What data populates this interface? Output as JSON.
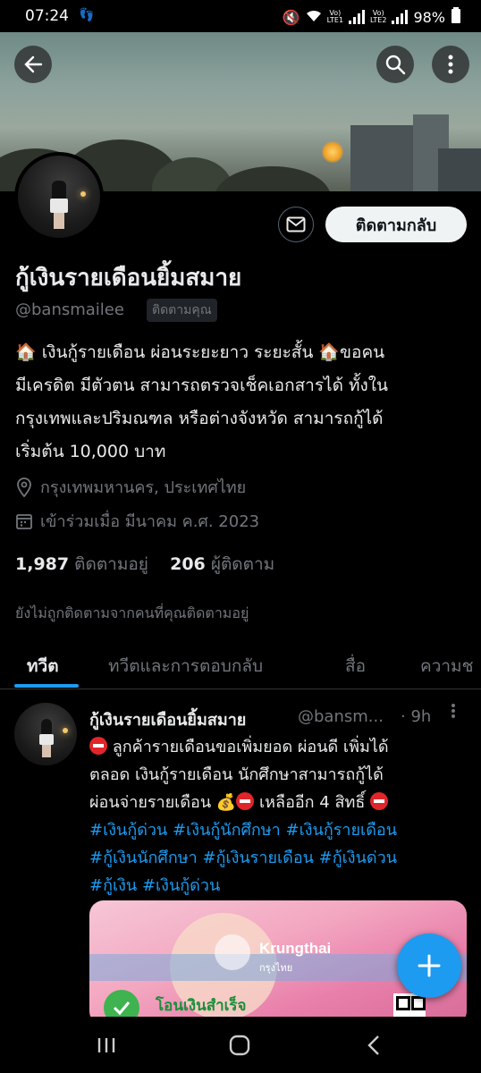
{
  "status_bar": {
    "time": "07:24",
    "battery": "98%",
    "sim1": "Vo)\nLTE1",
    "sim2": "Vo)\nLTE2"
  },
  "profile": {
    "display_name": "กู้เงินรายเดือนยิ้มสมาย",
    "handle": "@bansmailee",
    "follows_you_badge": "ติดตามคุณ",
    "follow_back_label": "ติดตามกลับ",
    "bio_lines": [
      "🏠 เงินกู้รายเดือน ผ่อนระยะยาว ระยะสั้น 🏠ขอคน",
      "มีเครดิต มีตัวตน สามารถตรวจเช็คเอกสารได้ ทั้งใน",
      "กรุงเทพและปริมณฑล หรือต่างจังหวัด สามารถกู้ได้",
      "เริ่มต้น 10,000 บาท"
    ],
    "location": "กรุงเทพมหานคร, ประเทศไทย",
    "joined": "เข้าร่วมเมื่อ มีนาคม ค.ศ. 2023",
    "following_count": "1,987",
    "following_label": "ติดตามอยู่",
    "followers_count": "206",
    "followers_label": "ผู้ติดตาม",
    "not_followed_note": "ยังไม่ถูกติดตามจากคนที่คุณติดตามอยู่"
  },
  "tabs": [
    {
      "label": "ทวีต"
    },
    {
      "label": "ทวีตและการตอบกลับ"
    },
    {
      "label": "สื่อ"
    },
    {
      "label": "ความช"
    }
  ],
  "tweet": {
    "name": "กู้เงินรายเดือนยิ้มสมาย",
    "handle": "@bansm...",
    "time": "· 9h",
    "line1": "ลูกค้ารายเดือนขอเพิ่มยอด ผ่อนดี เพิ่มได้",
    "line2": "ตลอด เงินกู้รายเดือน นักศึกษาสามารถกู้ได้",
    "line3a": "ผ่อนจ่ายรายเดือน 💰",
    "line3b": "เหลืออีก 4 สิทธิ์",
    "hashtags1": "#เงินกู้ด่วน #เงินกู้นักศึกษา #เงินกู้รายเดือน",
    "hashtags2": "#กู้เงินนักศึกษา #กู้เงินรายเดือน #กู้เงินด่วน",
    "hashtags3": "#กู้เงิน #เงินกู้ด่วน",
    "media_brand": "Krungthai",
    "media_brand_th": "กรุงไทย",
    "media_success": "โอนเงินสำเร็จ"
  },
  "colors": {
    "accent": "#1d9bf0",
    "background": "#000000",
    "muted": "#71767b"
  }
}
